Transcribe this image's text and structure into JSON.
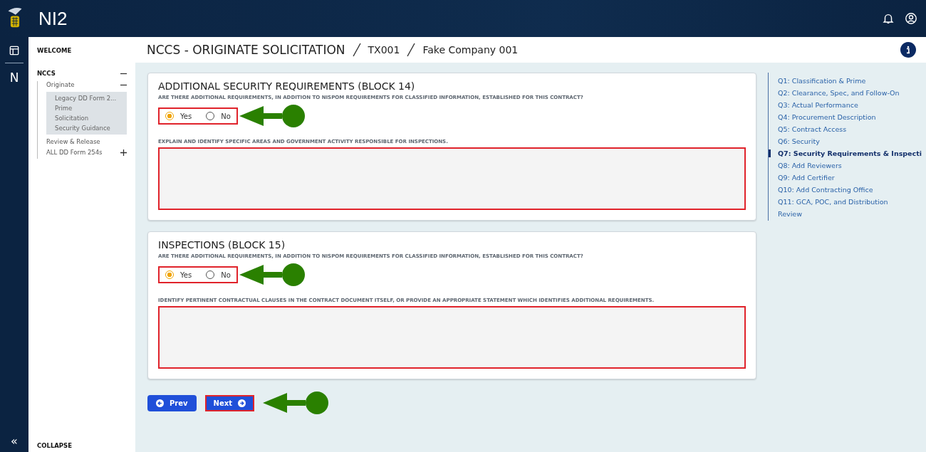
{
  "app": {
    "title": "NI2"
  },
  "rail": {
    "letter": "N",
    "collapse_glyph": "«"
  },
  "sidebar": {
    "welcome": "WELCOME",
    "collapse": "COLLAPSE",
    "items": [
      {
        "label": "NCCS",
        "expanded": true,
        "children": [
          {
            "label": "Originate",
            "expanded": true,
            "children": [
              {
                "label": "Legacy DD Form 2..."
              },
              {
                "label": "Prime"
              },
              {
                "label": "Solicitation"
              },
              {
                "label": "Security Guidance"
              }
            ]
          },
          {
            "label": "Review & Release"
          },
          {
            "label": "ALL DD Form 254s",
            "expanded": false
          }
        ]
      }
    ]
  },
  "breadcrumb": [
    "NCCS - ORIGINATE SOLICITATION",
    "TX001",
    "Fake Company 001"
  ],
  "sections": [
    {
      "title": "ADDITIONAL SECURITY REQUIREMENTS (BLOCK 14)",
      "question": "ARE THERE ADDITIONAL REQUIREMENTS, IN ADDITION TO NISPOM REQUIREMENTS FOR CLASSIFIED INFORMATION, ESTABLISHED FOR THIS CONTRACT?",
      "options": [
        {
          "label": "Yes",
          "selected": true
        },
        {
          "label": "No",
          "selected": false
        }
      ],
      "highlighted": true,
      "arrow": true,
      "field_label": "EXPLAIN AND IDENTIFY SPECIFIC AREAS AND GOVERNMENT ACTIVITY RESPONSIBLE FOR INSPECTIONS.",
      "field_highlighted": true
    },
    {
      "title": "INSPECTIONS (BLOCK 15)",
      "question": "ARE THERE ADDITIONAL REQUIREMENTS, IN ADDITION TO NISPOM REQUIREMENTS FOR CLASSIFIED INFORMATION, ESTABLISHED FOR THIS CONTRACT?",
      "options": [
        {
          "label": "Yes",
          "selected": true
        },
        {
          "label": "No",
          "selected": false
        }
      ],
      "highlighted": true,
      "arrow": true,
      "field_label": "IDENTIFY PERTINENT CONTRACTUAL CLAUSES IN THE CONTRACT DOCUMENT ITSELF, OR PROVIDE AN APPROPRIATE STATEMENT WHICH IDENTIFIES ADDITIONAL REQUIREMENTS.",
      "field_highlighted": true
    }
  ],
  "buttons": [
    {
      "label": "Prev",
      "kind": "prev",
      "highlighted": false,
      "arrow": false
    },
    {
      "label": "Next",
      "kind": "next",
      "highlighted": true,
      "arrow": true
    }
  ],
  "steps": [
    {
      "label": "Q1: Classification & Prime",
      "selected": false
    },
    {
      "label": "Q2: Clearance, Spec, and Follow-On",
      "selected": false
    },
    {
      "label": "Q3: Actual Performance",
      "selected": false
    },
    {
      "label": "Q4: Procurement Description",
      "selected": false
    },
    {
      "label": "Q5: Contract Access",
      "selected": false
    },
    {
      "label": "Q6: Security",
      "selected": false
    },
    {
      "label": "Q7: Security Requirements & Inspecti",
      "selected": true
    },
    {
      "label": "Q8: Add Reviewers",
      "selected": false
    },
    {
      "label": "Q9: Add Certifier",
      "selected": false
    },
    {
      "label": "Q10: Add Contracting Office",
      "selected": false
    },
    {
      "label": "Q11: GCA, POC, and Distribution",
      "selected": false
    },
    {
      "label": "Review",
      "selected": false
    }
  ]
}
